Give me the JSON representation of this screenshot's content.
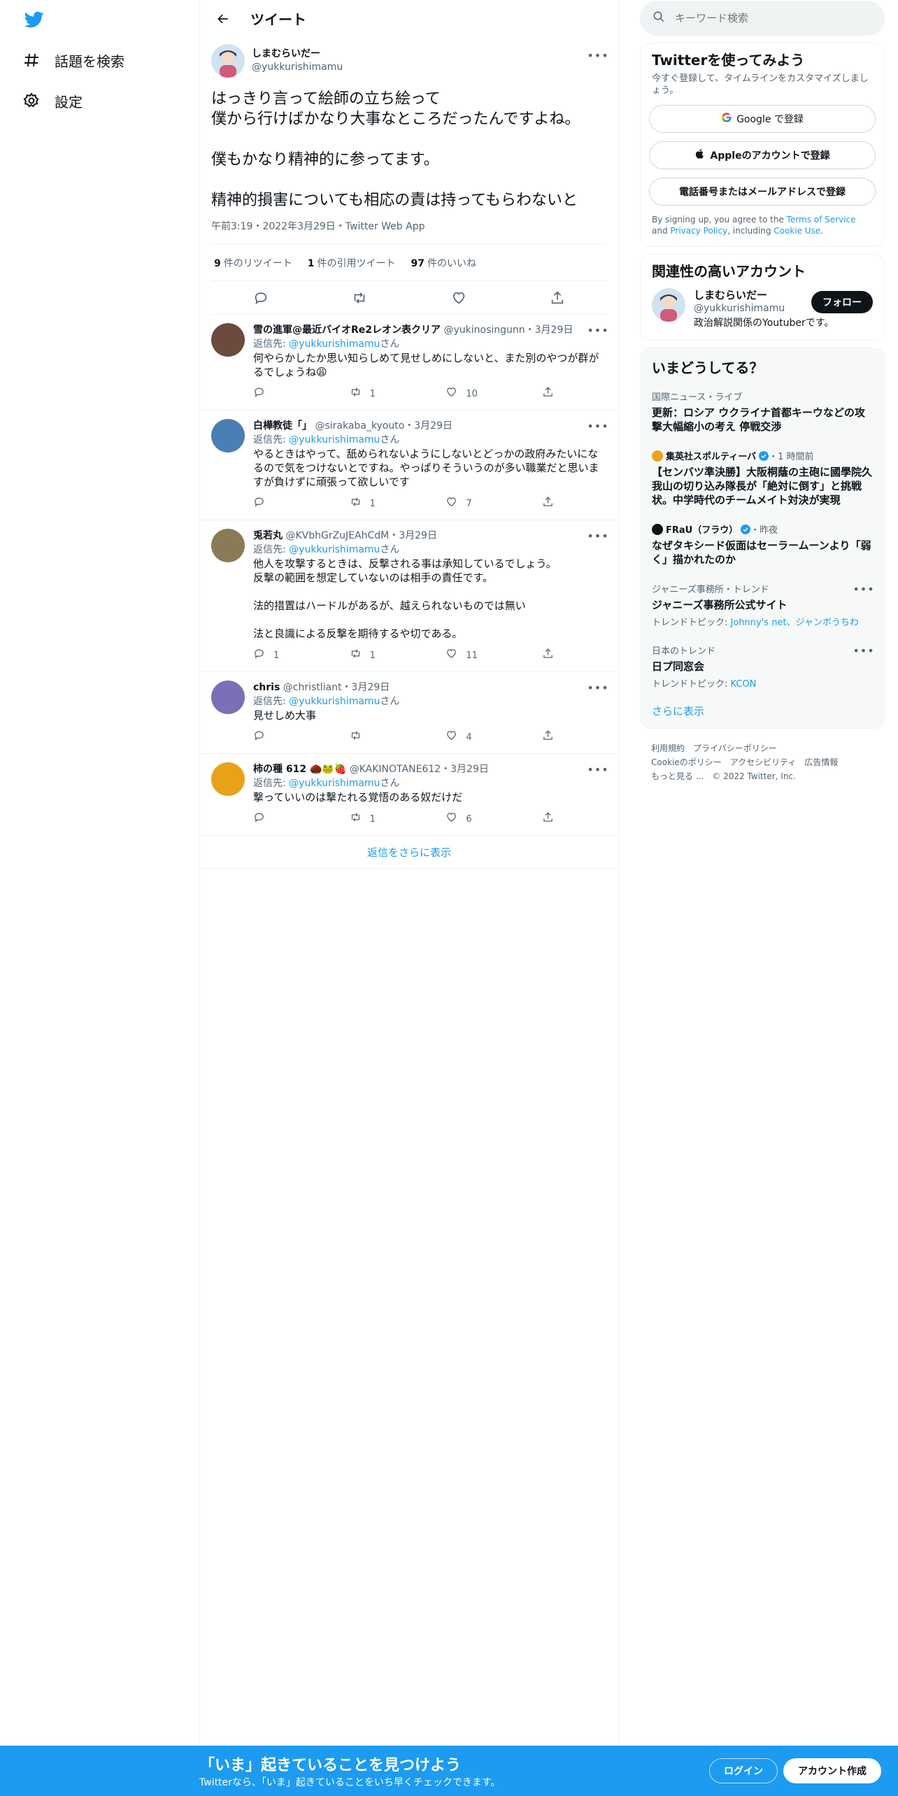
{
  "nav": {
    "logo": "twitter-bird",
    "items": [
      {
        "icon": "hashtag-icon",
        "label": "話題を検索"
      },
      {
        "icon": "gear-icon",
        "label": "設定"
      }
    ]
  },
  "header": {
    "title": "ツイート"
  },
  "focal": {
    "name": "しまむらいだー",
    "handle": "@yukkurishimamu",
    "text": "はっきり言って絵師の立ち絵って\n僕から行けばかなり大事なところだったんですよね。\n\n僕もかなり精神的に参ってます。\n\n精神的損害についても相応の責は持ってもらわないと",
    "timestamp": "午前3:19・2022年3月29日・Twitter Web App",
    "retweets": "9",
    "retweets_label": "件のリツイート",
    "quotes": "1",
    "quotes_label": "件の引用ツイート",
    "likes": "97",
    "likes_label": "件のいいね"
  },
  "reply_to_label": "返信先:",
  "reply_to_suffix": "さん",
  "reply_to_handle": "@yukkurishimamu",
  "replies": [
    {
      "name": "雪の進軍@最近バイオRe2レオン表クリア",
      "handle": "@yukinosingunn",
      "date": "・3月29日",
      "text": "何やらかしたか思い知らしめて見せしめにしないと、また別のやつが群がるでしょうね😩",
      "replies": "",
      "retweets": "1",
      "likes": "10"
    },
    {
      "name": "白樺教徒「」",
      "handle": "@sirakaba_kyouto",
      "date": "・3月29日",
      "text": "やるときはやって、舐められないようにしないとどっかの政府みたいになるので気をつけないとですね。やっぱりそういうのが多い職業だと思いますが負けずに頑張って欲しいです",
      "replies": "",
      "retweets": "1",
      "likes": "7"
    },
    {
      "name": "兎若丸",
      "handle": "@KVbhGrZuJEAhCdM",
      "date": "・3月29日",
      "text": "他人を攻撃するときは、反撃される事は承知しているでしょう。\n反撃の範囲を想定していないのは相手の責任です。\n\n法的措置はハードルがあるが、越えられないものでは無い\n\n法と良識による反撃を期待するや切である。",
      "replies": "1",
      "retweets": "1",
      "likes": "11"
    },
    {
      "name": "chris",
      "handle": "@christliant",
      "date": "・3月29日",
      "text": "見せしめ大事",
      "replies": "",
      "retweets": "",
      "likes": "4"
    },
    {
      "name": "柿の種 612 🌰🐸🍓",
      "handle": "@KAKINOTANE612",
      "date": "・3月29日",
      "text": "撃っていいのは撃たれる覚悟のある奴だけだ",
      "replies": "",
      "retweets": "1",
      "likes": "6"
    }
  ],
  "show_more_replies": "返信をさらに表示",
  "search": {
    "placeholder": "キーワード検索"
  },
  "signup": {
    "title": "Twitterを使ってみよう",
    "subtitle": "今すぐ登録して、タイムラインをカスタマイズしましょう。",
    "google": "Google で登録",
    "apple": "Appleのアカウントで登録",
    "phone": "電話番号またはメールアドレスで登録",
    "legal_1": "By signing up, you agree to the ",
    "tos": "Terms of Service",
    "legal_2": " and ",
    "privacy": "Privacy Policy",
    "legal_3": ", including ",
    "cookie": "Cookie Use",
    "legal_4": "."
  },
  "related": {
    "title": "関連性の高いアカウント",
    "name": "しまむらいだー",
    "handle": "@yukkurishimamu",
    "bio": "政治解説関係のYoutuberです。",
    "follow": "フォロー"
  },
  "trends": {
    "title": "いまどうしてる？",
    "items": [
      {
        "context": "国際ニュース・ライブ",
        "title": "更新：ロシア ウクライナ首都キーウなどの攻撃大幅縮小の考え 停戦交渉",
        "topics": ""
      },
      {
        "context": "集英社スポルティーバ",
        "meta": "・1 時間前",
        "title": "【センバツ準決勝】大阪桐蔭の主砲に國學院久我山の切り込み隊長が「絶対に倒す」と挑戦状。中学時代のチームメイト対決が実現",
        "topics": ""
      },
      {
        "context": "FRaU（フラウ）",
        "meta": "・昨夜",
        "title": "なぜタキシード仮面はセーラームーンより「弱く」描かれたのか",
        "topics": ""
      },
      {
        "context": "ジャニーズ事務所・トレンド",
        "title": "ジャニーズ事務所公式サイト",
        "topics_label": "トレンドトピック:",
        "topics": "Johnny's net、ジャンボうちわ"
      },
      {
        "context": "日本のトレンド",
        "title": "日プ同窓会",
        "topics_label": "トレンドトピック:",
        "topics": "KCON"
      }
    ],
    "show_more": "さらに表示"
  },
  "footer": {
    "links": [
      "利用規約",
      "プライバシーポリシー",
      "Cookieのポリシー",
      "アクセシビリティ",
      "広告情報",
      "もっと見る ..."
    ],
    "copyright": "© 2022 Twitter, Inc."
  },
  "bottombar": {
    "title": "「いま」起きていることを見つけよう",
    "subtitle": "Twitterなら、「いま」起きていることをいち早くチェックできます。",
    "login": "ログイン",
    "signup": "アカウント作成"
  },
  "colors": {
    "accent": "#1d9bf0",
    "text": "#0f1419",
    "muted": "#536471",
    "border": "#eff3f4"
  }
}
